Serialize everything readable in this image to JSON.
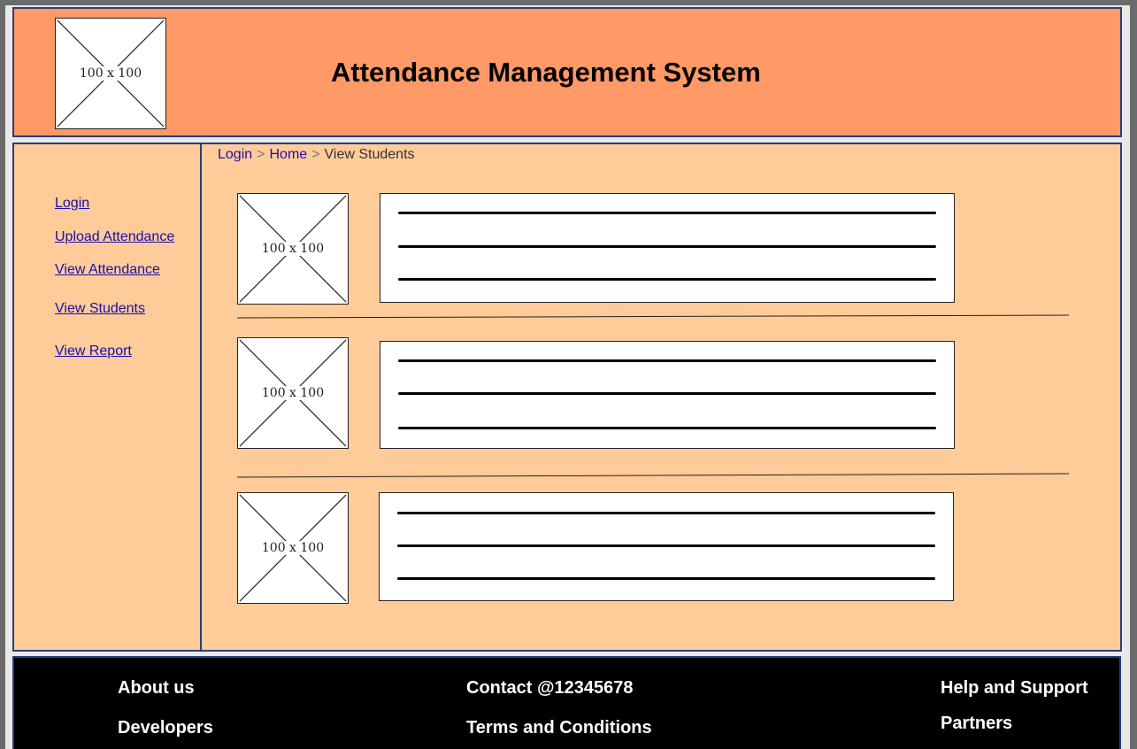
{
  "header": {
    "logo_placeholder": "100 x 100",
    "title": "Attendance Management System"
  },
  "sidebar": {
    "items": [
      {
        "label": "Login"
      },
      {
        "label": "Upload Attendance"
      },
      {
        "label": "View Attendance"
      },
      {
        "label": "View Students"
      },
      {
        "label": "View Report"
      }
    ]
  },
  "breadcrumb": {
    "items": [
      "Login",
      "Home",
      "View Students"
    ],
    "separator": ">"
  },
  "students": {
    "rows": [
      {
        "image_placeholder": "100 x 100"
      },
      {
        "image_placeholder": "100 x 100"
      },
      {
        "image_placeholder": "100 x 100"
      }
    ]
  },
  "footer": {
    "about": "About us",
    "developers": "Developers",
    "contact": "Contact @12345678",
    "terms": "Terms and Conditions",
    "help": "Help and Support",
    "partners": "Partners"
  },
  "colors": {
    "header_bg": "#ff9966",
    "content_bg": "#ffcc99",
    "border": "#2b3d7c",
    "footer_bg": "#000000",
    "link": "#1a0dab"
  }
}
